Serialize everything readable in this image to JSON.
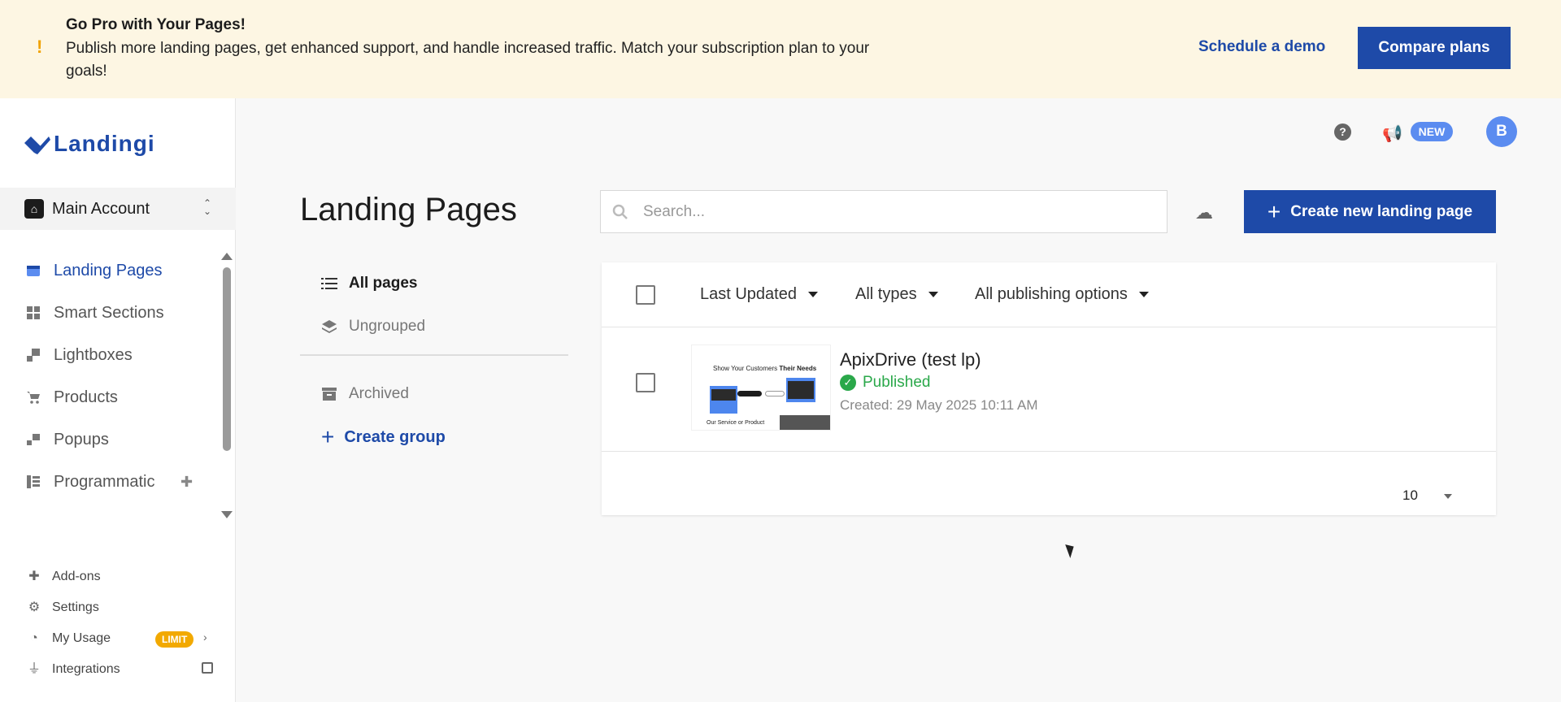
{
  "banner": {
    "title": "Go Pro with Your Pages!",
    "text": "Publish more landing pages, get enhanced support, and handle increased traffic. Match your subscription plan to your goals!",
    "demo_label": "Schedule a demo",
    "compare_label": "Compare plans",
    "accent": "#f0a202"
  },
  "brand": {
    "name": "Landingi",
    "color": "#1e4aa8"
  },
  "account": {
    "name": "Main Account"
  },
  "sidebar": {
    "items": [
      {
        "label": "Landing Pages",
        "icon": "landing-pages-icon",
        "active": true
      },
      {
        "label": "Smart Sections",
        "icon": "smart-sections-icon"
      },
      {
        "label": "Lightboxes",
        "icon": "lightboxes-icon"
      },
      {
        "label": "Products",
        "icon": "cart-icon"
      },
      {
        "label": "Popups",
        "icon": "popups-icon"
      },
      {
        "label": "Programmatic",
        "icon": "programmatic-icon"
      }
    ],
    "bottom": [
      {
        "label": "Add-ons",
        "icon": "puzzle-icon"
      },
      {
        "label": "Settings",
        "icon": "gear-icon"
      },
      {
        "label": "My Usage",
        "icon": "usage-icon",
        "badge": "LIMIT"
      },
      {
        "label": "Integrations",
        "icon": "plug-icon"
      }
    ]
  },
  "topbar": {
    "new_badge": "NEW",
    "avatar_initial": "B"
  },
  "page": {
    "title": "Landing Pages"
  },
  "search": {
    "placeholder": "Search..."
  },
  "create_button": {
    "label": "Create new landing page"
  },
  "groups": {
    "all": "All pages",
    "ungrouped": "Ungrouped",
    "archived": "Archived",
    "create": "Create group"
  },
  "filters": {
    "sort": "Last Updated",
    "types": "All types",
    "publishing": "All publishing options"
  },
  "pages": [
    {
      "name": "ApixDrive (test lp)",
      "status": "Published",
      "created": "Created: 29 May 2025 10:11 AM",
      "thumb_title_start": "Show Your Customers ",
      "thumb_title_bold": "Their Needs",
      "thumb_footer": "Our Service or Product"
    }
  ],
  "pagination": {
    "per_page": "10"
  }
}
